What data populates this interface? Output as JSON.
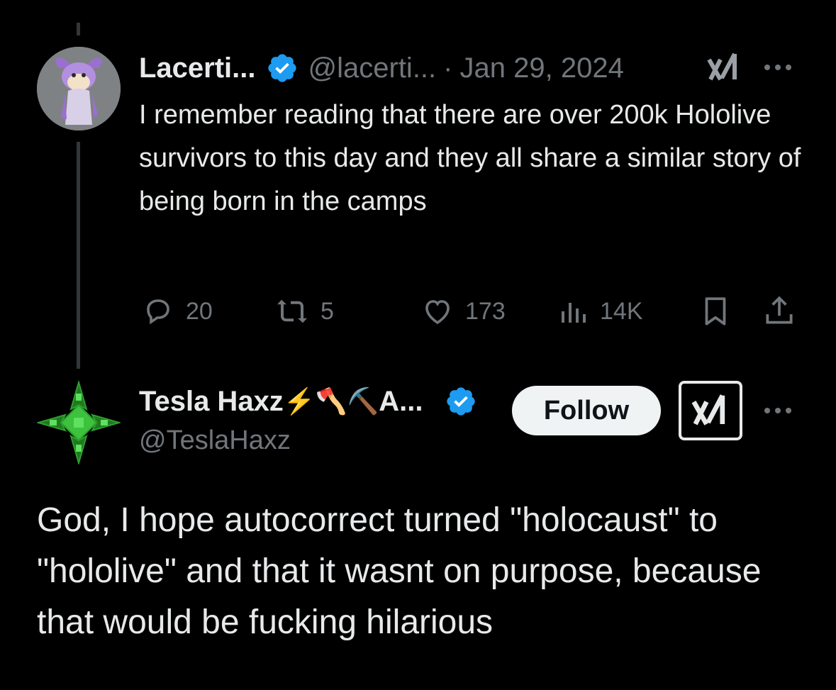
{
  "tweet1": {
    "display_name": "Lacerti...",
    "handle": "@lacerti...",
    "separator": "·",
    "date": "Jan 29, 2024",
    "text": "I remember reading that there are over 200k Hololive survivors to this day and they all share a similar story of being born in the camps",
    "actions": {
      "replies": "20",
      "reposts": "5",
      "likes": "173",
      "views": "14K"
    }
  },
  "tweet2": {
    "display_name": "Tesla Haxz",
    "name_emojis": "⚡🪓⛏️",
    "name_suffix": "A...",
    "handle": "@TeslaHaxz",
    "follow_label": "Follow",
    "text": "God, I hope autocorrect turned \"holocaust\" to \"hololive\" and that it wasnt on purpose, because that would be fucking hilarious"
  },
  "colors": {
    "background": "#000000",
    "text_primary": "#e7e9ea",
    "text_secondary": "#71767b",
    "verified_blue": "#1d9bf0",
    "follow_button_bg": "#eff3f4"
  },
  "icons": [
    "verified-badge-icon",
    "grok-icon",
    "more-icon",
    "reply-icon",
    "repost-icon",
    "like-icon",
    "views-icon",
    "bookmark-icon",
    "share-icon"
  ]
}
